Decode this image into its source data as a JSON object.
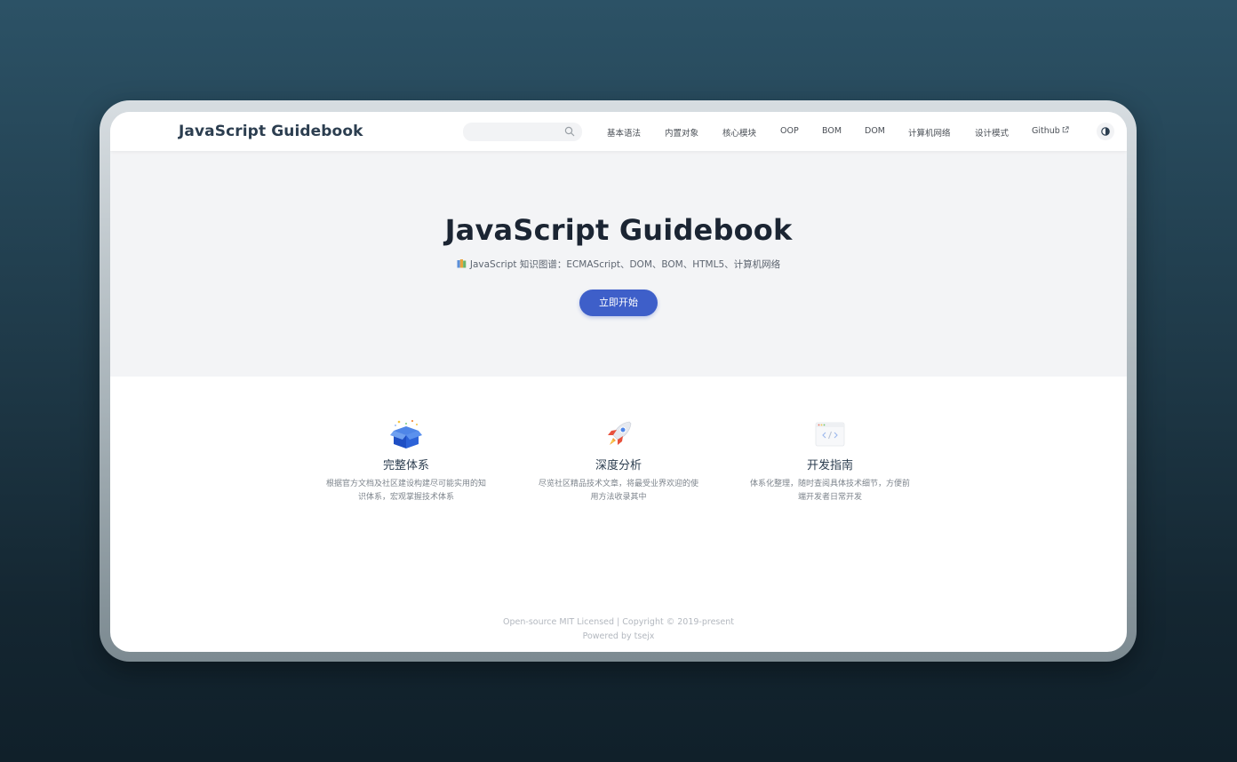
{
  "brand": "JavaScript Guidebook",
  "search": {
    "placeholder": ""
  },
  "nav": {
    "links": [
      "基本语法",
      "内置对象",
      "核心模块",
      "OOP",
      "BOM",
      "DOM",
      "计算机网络",
      "设计模式"
    ],
    "github": "Github"
  },
  "hero": {
    "title": "JavaScript Guidebook",
    "description": "JavaScript 知识图谱：ECMAScript、DOM、BOM、HTML5、计算机网络",
    "cta": "立即开始"
  },
  "features": [
    {
      "icon": "gift-box-icon",
      "title": "完整体系",
      "desc": "根据官方文档及社区建设构建尽可能实用的知识体系，宏观掌握技术体系"
    },
    {
      "icon": "rocket-icon",
      "title": "深度分析",
      "desc": "尽览社区精品技术文章，将最受业界欢迎的使用方法收录其中"
    },
    {
      "icon": "code-window-icon",
      "title": "开发指南",
      "desc": "体系化整理，随时查阅具体技术细节，方便前端开发者日常开发"
    }
  ],
  "footer": {
    "line1": "Open-source MIT Licensed | Copyright © 2019-present",
    "line2": "Powered by tsejx"
  },
  "colors": {
    "primary": "#3e5fc9",
    "hero_bg": "#f3f4f6",
    "text_dark": "#2c3e50"
  }
}
